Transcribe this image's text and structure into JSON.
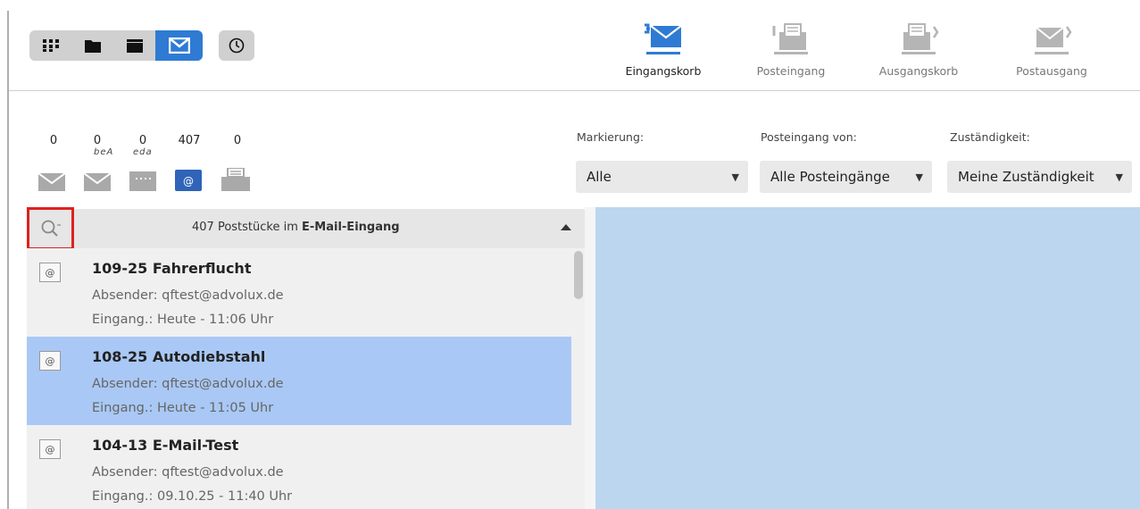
{
  "toolbar": {
    "views": [
      "grid-view",
      "folder-view",
      "list-view",
      "mail-view"
    ],
    "active_view": "mail-view",
    "clock": "clock"
  },
  "mail_tabs": [
    {
      "label": "Eingangskorb",
      "icon": "inbox-basket-icon",
      "active": true
    },
    {
      "label": "Posteingang",
      "icon": "incoming-mail-icon",
      "active": false
    },
    {
      "label": "Ausgangskorb",
      "icon": "outbox-basket-icon",
      "active": false
    },
    {
      "label": "Postausgang",
      "icon": "outgoing-mail-icon",
      "active": false
    }
  ],
  "counters": [
    {
      "count": "0",
      "icon": "envelope-icon",
      "label": ""
    },
    {
      "count": "0",
      "icon": "bea-envelope-icon",
      "label": "beA"
    },
    {
      "count": "0",
      "icon": "eda-icon",
      "label": "eda"
    },
    {
      "count": "407",
      "icon": "email-at-icon",
      "label": ""
    },
    {
      "count": "0",
      "icon": "fax-icon",
      "label": ""
    }
  ],
  "filters": {
    "markierung": {
      "label": "Markierung:",
      "value": "Alle"
    },
    "posteingang_von": {
      "label": "Posteingang von:",
      "value": "Alle Posteingänge"
    },
    "zustaendigkeit": {
      "label": "Zuständigkeit:",
      "value": "Meine Zuständigkeit"
    }
  },
  "list": {
    "title_prefix": "407 Poststücke im ",
    "title_bold": "E-Mail-Eingang",
    "items": [
      {
        "title": "109-25 Fahrerflucht",
        "sender": "Absender: qftest@advolux.de",
        "date": "Eingang.: Heute - 11:06 Uhr",
        "selected": false,
        "badge": "@"
      },
      {
        "title": "108-25 Autodiebstahl",
        "sender": "Absender: qftest@advolux.de",
        "date": "Eingang.: Heute - 11:05 Uhr",
        "selected": true,
        "badge": "@"
      },
      {
        "title": "104-13 E-Mail-Test",
        "sender": "Absender: qftest@advolux.de",
        "date": "Eingang.: 09.10.25 - 11:40 Uhr",
        "selected": false,
        "badge": "@"
      }
    ]
  },
  "colors": {
    "accent": "#2f7bd3",
    "selected_row": "#a9c8f5",
    "detail_bg": "#bcd6f0",
    "highlight": "#e02020"
  }
}
